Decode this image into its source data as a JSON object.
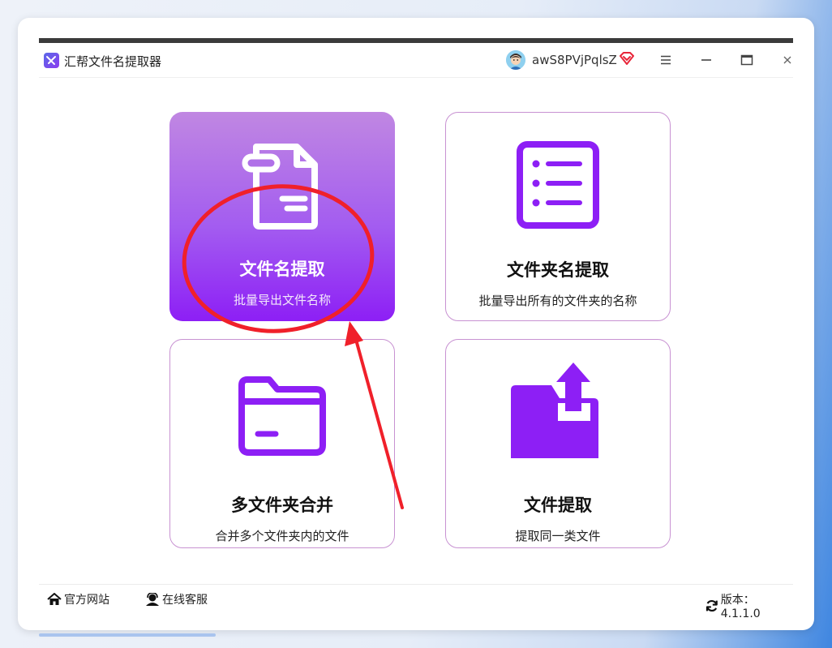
{
  "app": {
    "title": "汇帮文件名提取器",
    "username": "awS8PVjPqlsZ"
  },
  "tiles": [
    {
      "title": "文件名提取",
      "subtitle": "批量导出文件名称",
      "icon": "file-document-icon",
      "selected": true
    },
    {
      "title": "文件夹名提取",
      "subtitle": "批量导出所有的文件夹的名称",
      "icon": "list-icon",
      "selected": false
    },
    {
      "title": "多文件夹合并",
      "subtitle": "合并多个文件夹内的文件",
      "icon": "folder-icon",
      "selected": false
    },
    {
      "title": "文件提取",
      "subtitle": "提取同一类文件",
      "icon": "folder-export-icon",
      "selected": false
    }
  ],
  "statusbar": {
    "website": "官方网站",
    "support": "在线客服",
    "version": "版本：4.1.1.0"
  },
  "colors": {
    "accent": "#8d1ff5",
    "tile_border": "#c892d2",
    "annotation": "#f0202a"
  }
}
